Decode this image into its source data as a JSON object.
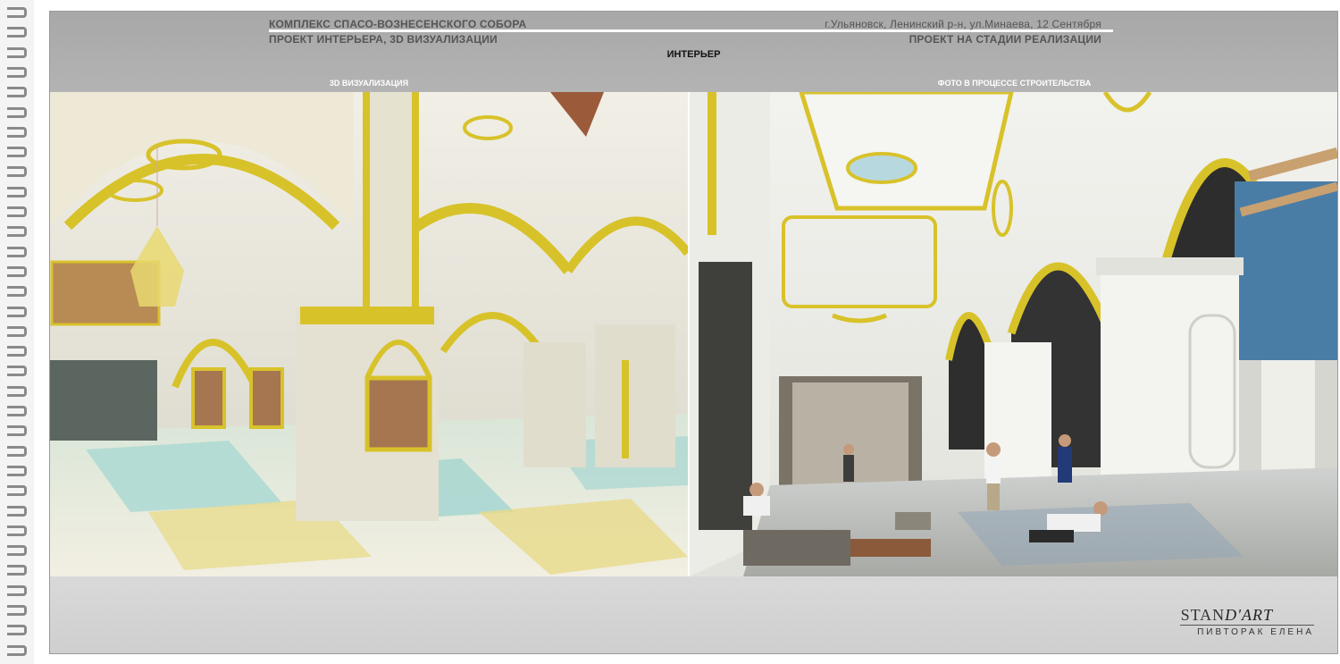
{
  "header": {
    "title_left_1": "КОМПЛЕКС СПАСО-ВОЗНЕСЕНСКОГО СОБОРА",
    "title_left_2": "ПРОЕКТ ИНТЕРЬЕРА, 3D ВИЗУАЛИЗАЦИИ",
    "title_right_1": "г.Ульяновск, Ленинский р-н, ул.Минаева, 12 Сентября",
    "title_right_2": "ПРОЕКТ НА СТАДИИ РЕАЛИЗАЦИИ",
    "section": "ИНТЕРЬЕР"
  },
  "panels": {
    "left_label": "3D ВИЗУАЛИЗАЦИЯ",
    "right_label": "ФОТО В ПРОЦЕССЕ СТРОИТЕЛЬСТВА"
  },
  "logo": {
    "brand_a": "STAN",
    "brand_b": "D'ART",
    "author": "ПИВТОРАК ЕЛЕНА"
  },
  "colors": {
    "header_band": "#a8a8a8",
    "gold": "#d8c22a",
    "wall": "#ece9dc",
    "floor_teal": "#9fd3cf",
    "floor_yellow": "#e8dc8f",
    "dome_blue": "#4a7da6"
  }
}
